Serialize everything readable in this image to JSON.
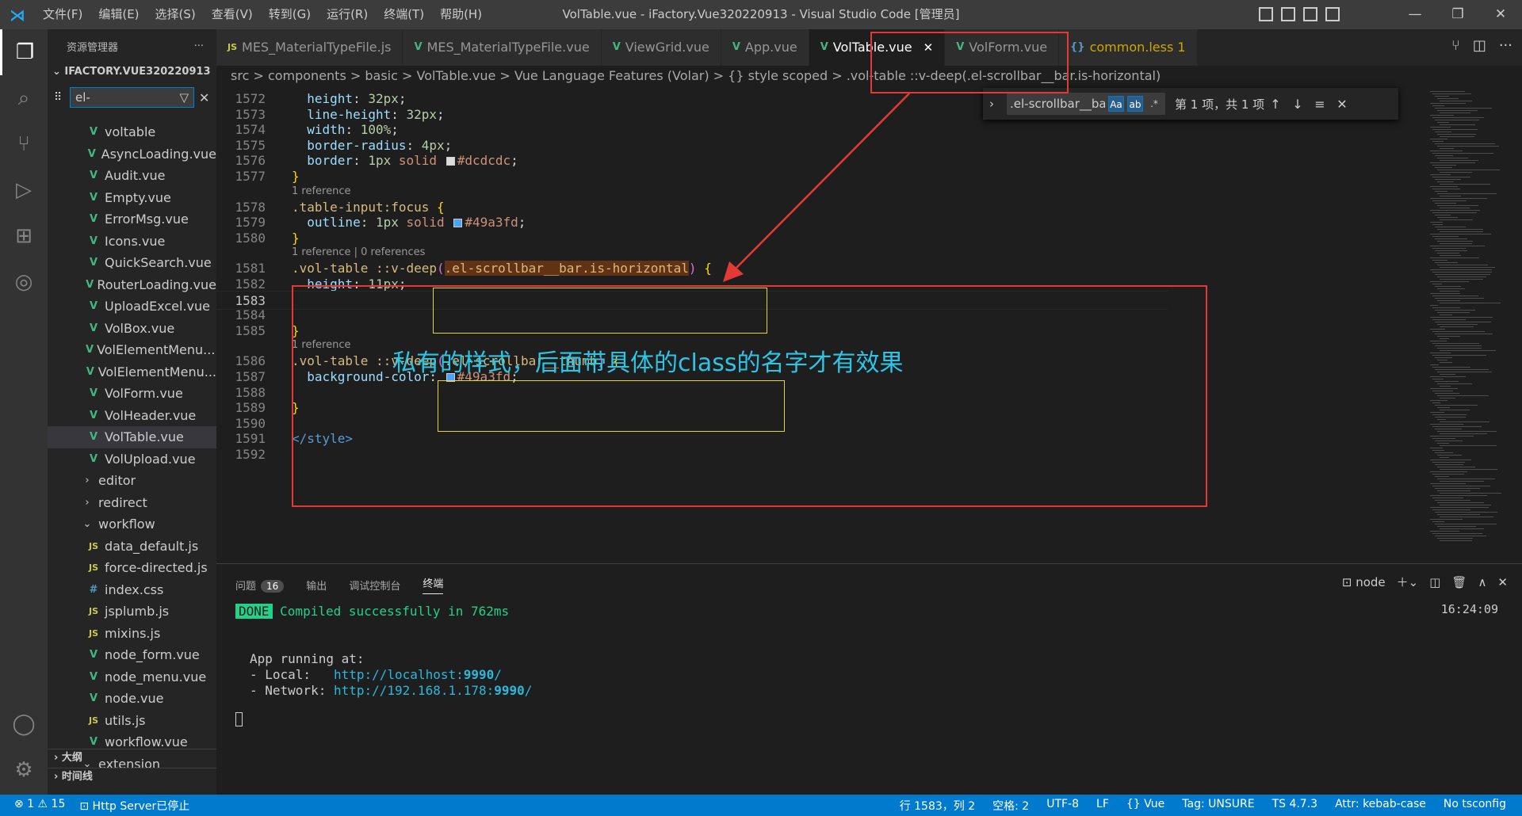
{
  "window": {
    "title": "VolTable.vue - iFactory.Vue320220913 - Visual Studio Code [管理员]",
    "menu": [
      "文件(F)",
      "编辑(E)",
      "选择(S)",
      "查看(V)",
      "转到(G)",
      "运行(R)",
      "终端(T)",
      "帮助(H)"
    ]
  },
  "sidebar": {
    "title": "资源管理器",
    "more": "···",
    "root": "IFACTORY.VUE320220913",
    "filter_value": "el-",
    "items": [
      {
        "icon": "vue",
        "label": "voltable"
      },
      {
        "icon": "vue",
        "label": "AsyncLoading.vue"
      },
      {
        "icon": "vue",
        "label": "Audit.vue"
      },
      {
        "icon": "vue",
        "label": "Empty.vue"
      },
      {
        "icon": "vue",
        "label": "ErrorMsg.vue"
      },
      {
        "icon": "vue",
        "label": "Icons.vue"
      },
      {
        "icon": "vue",
        "label": "QuickSearch.vue"
      },
      {
        "icon": "vue",
        "label": "RouterLoading.vue"
      },
      {
        "icon": "vue",
        "label": "UploadExcel.vue"
      },
      {
        "icon": "vue",
        "label": "VolBox.vue"
      },
      {
        "icon": "vue",
        "label": "VolElementMenu...."
      },
      {
        "icon": "vue",
        "label": "VolElementMenu..."
      },
      {
        "icon": "vue",
        "label": "VolForm.vue"
      },
      {
        "icon": "vue",
        "label": "VolHeader.vue"
      },
      {
        "icon": "vue",
        "label": "VolTable.vue",
        "selected": true
      },
      {
        "icon": "vue",
        "label": "VolUpload.vue"
      },
      {
        "icon": "chev-right",
        "label": "editor"
      },
      {
        "icon": "chev-right",
        "label": "redirect"
      },
      {
        "icon": "chev-down",
        "label": "workflow"
      },
      {
        "icon": "js",
        "label": "data_default.js"
      },
      {
        "icon": "js",
        "label": "force-directed.js"
      },
      {
        "icon": "css",
        "label": "index.css"
      },
      {
        "icon": "js",
        "label": "jsplumb.js"
      },
      {
        "icon": "js",
        "label": "mixins.js"
      },
      {
        "icon": "vue",
        "label": "node_form.vue"
      },
      {
        "icon": "vue",
        "label": "node_menu.vue"
      },
      {
        "icon": "vue",
        "label": "node.vue"
      },
      {
        "icon": "js",
        "label": "utils.js"
      },
      {
        "icon": "vue",
        "label": "workflow.vue"
      },
      {
        "icon": "chev-down",
        "label": "extension"
      }
    ],
    "outline": "大纲",
    "timeline": "时间线"
  },
  "tabs": [
    {
      "icon": "JS",
      "label": "MES_MaterialTypeFile.js"
    },
    {
      "icon": "V",
      "label": "MES_MaterialTypeFile.vue"
    },
    {
      "icon": "V",
      "label": "ViewGrid.vue"
    },
    {
      "icon": "V",
      "label": "App.vue"
    },
    {
      "icon": "V",
      "label": "VolTable.vue",
      "active": true
    },
    {
      "icon": "V",
      "label": "VolForm.vue"
    },
    {
      "icon": "{}",
      "label": "common.less 1"
    }
  ],
  "breadcrumb": "src  >  components  >  basic  >  VolTable.vue  >  Vue Language Features (Volar)  >  {} style scoped  >  .vol-table ::v-deep(.el-scrollbar__bar.is-horizontal)",
  "find": {
    "value": ".el-scrollbar__bar.is-horizontal",
    "opt_case": "Aa",
    "opt_word": "ab",
    "opt_regex": ".*",
    "count": "第 1 项，共 1 项"
  },
  "editor": {
    "cursor_line": "1583",
    "lines": [
      {
        "n": "1572",
        "parts": [
          [
            "",
            "  "
          ],
          [
            "prop",
            "height"
          ],
          [
            "",
            ": "
          ],
          [
            "num",
            "32px"
          ],
          [
            "",
            ";"
          ]
        ]
      },
      {
        "n": "1573",
        "parts": [
          [
            "",
            "  "
          ],
          [
            "prop",
            "line-height"
          ],
          [
            "",
            ": "
          ],
          [
            "num",
            "32px"
          ],
          [
            "",
            ";"
          ]
        ]
      },
      {
        "n": "1574",
        "parts": [
          [
            "",
            "  "
          ],
          [
            "prop",
            "width"
          ],
          [
            "",
            ": "
          ],
          [
            "num",
            "100%"
          ],
          [
            "",
            ";"
          ]
        ]
      },
      {
        "n": "1575",
        "parts": [
          [
            "",
            "  "
          ],
          [
            "prop",
            "border-radius"
          ],
          [
            "",
            ": "
          ],
          [
            "num",
            "4px"
          ],
          [
            "",
            ";"
          ]
        ]
      },
      {
        "n": "1576",
        "parts": [
          [
            "",
            "  "
          ],
          [
            "prop",
            "border"
          ],
          [
            "",
            ": "
          ],
          [
            "num",
            "1px"
          ],
          [
            "",
            " "
          ],
          [
            "str",
            "solid"
          ],
          [
            "",
            " "
          ],
          [
            "swatch:#dcdcdc",
            ""
          ],
          [
            "str",
            "#dcdcdc"
          ],
          [
            "",
            ";"
          ]
        ]
      },
      {
        "n": "1577",
        "parts": [
          [
            "brace-y",
            "}"
          ]
        ]
      },
      {
        "lens": "1 reference"
      },
      {
        "n": "1578",
        "parts": [
          [
            "sel-c",
            ".table-input:focus"
          ],
          [
            "",
            " "
          ],
          [
            "brace-y",
            "{"
          ]
        ]
      },
      {
        "n": "1579",
        "parts": [
          [
            "",
            "  "
          ],
          [
            "prop",
            "outline"
          ],
          [
            "",
            ": "
          ],
          [
            "num",
            "1px"
          ],
          [
            "",
            " "
          ],
          [
            "str",
            "solid"
          ],
          [
            "",
            " "
          ],
          [
            "swatch:#49a3fd",
            ""
          ],
          [
            "str",
            "#49a3fd"
          ],
          [
            "",
            ";"
          ]
        ]
      },
      {
        "n": "1580",
        "parts": [
          [
            "brace-y",
            "}"
          ]
        ]
      },
      {
        "lens": "1 reference | 0 references"
      },
      {
        "n": "1581",
        "parts": [
          [
            "sel-c",
            ".vol-table ::v-deep"
          ],
          [
            "brace-p",
            "("
          ],
          [
            "hl",
            ".el-scrollbar__bar.is-horizontal"
          ],
          [
            "brace-p",
            ")"
          ],
          [
            "",
            " "
          ],
          [
            "brace-y",
            "{"
          ]
        ]
      },
      {
        "n": "1582",
        "parts": [
          [
            "",
            "  "
          ],
          [
            "prop",
            "height"
          ],
          [
            "",
            ": "
          ],
          [
            "num",
            "11px"
          ],
          [
            "",
            ";"
          ]
        ]
      },
      {
        "n": "1583",
        "parts": []
      },
      {
        "n": "1584",
        "parts": []
      },
      {
        "n": "1585",
        "parts": [
          [
            "brace-y",
            "}"
          ]
        ]
      },
      {
        "lens": "1 reference"
      },
      {
        "n": "1586",
        "parts": [
          [
            "sel-c",
            ".vol-table ::v-deep"
          ],
          [
            "brace-p",
            "("
          ],
          [
            "sel-c",
            ".el-scrollbar__thumb"
          ],
          [
            "brace-p",
            ")"
          ],
          [
            "",
            " "
          ],
          [
            "brace-y",
            "{"
          ]
        ]
      },
      {
        "n": "1587",
        "parts": [
          [
            "",
            "  "
          ],
          [
            "prop",
            "background-color"
          ],
          [
            "",
            ": "
          ],
          [
            "swatch:#49a3fd",
            ""
          ],
          [
            "str",
            "#49a3fd"
          ],
          [
            "",
            ";"
          ]
        ]
      },
      {
        "n": "1588",
        "parts": []
      },
      {
        "n": "1589",
        "parts": [
          [
            "brace-y",
            "}"
          ]
        ]
      },
      {
        "n": "1590",
        "parts": []
      },
      {
        "n": "1591",
        "parts": [
          [
            "kw",
            "</style>"
          ]
        ]
      },
      {
        "n": "1592",
        "parts": []
      }
    ]
  },
  "annotation_text": "私有的样式，后面带具体的class的名字才有效果",
  "panel": {
    "tabs": [
      "问题",
      "输出",
      "调试控制台",
      "终端"
    ],
    "problem_count": "16",
    "shell": "node",
    "time": "16:24:09",
    "done": "DONE",
    "compiled": " Compiled successfully in 762ms",
    "app_running": "App running at:",
    "local_label": "- Local:   ",
    "local_url_a": "http://localhost:",
    "local_port": "9990",
    "local_url_b": "/",
    "network_label": "- Network: ",
    "network_url_a": "http://192.168.1.178:",
    "network_port": "9990",
    "network_url_b": "/"
  },
  "status": {
    "errors": "⊗ 1 ⚠ 15",
    "server": "Http Server已停止",
    "position": "行 1583，列 2",
    "spaces": "空格: 2",
    "encoding": "UTF-8",
    "eol": "LF",
    "lang": "{} Vue",
    "tag": "Tag: UNSURE",
    "ts": "TS 4.7.3",
    "attr": "Attr: kebab-case",
    "tsconfig": "No tsconfig"
  },
  "colors": {
    "accent": "#007acc",
    "annotation_red": "#e53935",
    "annotation_cyan": "#2dc5e6",
    "vue_green": "#41b883"
  }
}
